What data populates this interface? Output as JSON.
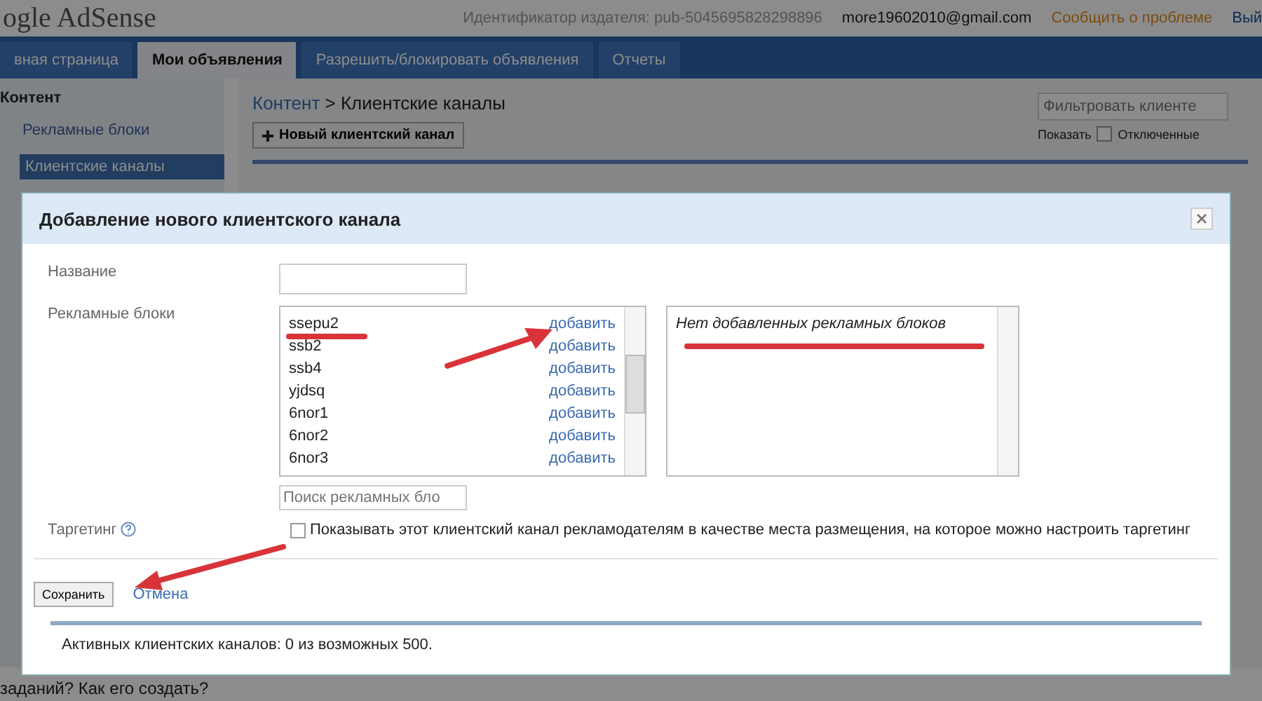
{
  "header": {
    "logo": "ogle AdSense",
    "publisher_id": "Идентификатор издателя: pub-5045695828298896",
    "email": "more19602010@gmail.com",
    "report_link": "Сообщить о проблеме",
    "cut_link": "Вый"
  },
  "nav_tabs": [
    {
      "label": "вная страница",
      "selected": false
    },
    {
      "label": "Мои объявления",
      "selected": true
    },
    {
      "label": "Разрешить/блокировать объявления",
      "selected": false
    },
    {
      "label": "Отчеты",
      "selected": false
    }
  ],
  "sidebar": {
    "heading": "Контент",
    "items": [
      {
        "label": "Рекламные блоки",
        "selected": false
      },
      {
        "label": "Клиентские каналы",
        "selected": true
      }
    ]
  },
  "content": {
    "breadcrumb_parent": "Контент",
    "breadcrumb_current": "> Клиентские каналы",
    "new_button": "Новый клиентский канал",
    "filter_placeholder": "Фильтровать клиенте",
    "show_label": "Показать",
    "disabled_filter": {
      "label": "Отключенные",
      "checked": false
    }
  },
  "footer_text": "заданий? Как его создать?",
  "dialog": {
    "title": "Добавление нового клиентского канала",
    "name_label": "Название",
    "ad_units_label": "Рекламные блоки",
    "ad_units": [
      {
        "name": "ssepu2",
        "action": "добавить"
      },
      {
        "name": "ssb2",
        "action": "добавить"
      },
      {
        "name": "ssb4",
        "action": "добавить"
      },
      {
        "name": "yjdsq",
        "action": "добавить"
      },
      {
        "name": "6nor1",
        "action": "добавить"
      },
      {
        "name": "6nor2",
        "action": "добавить"
      },
      {
        "name": "6nor3",
        "action": "добавить"
      }
    ],
    "search_placeholder": "Поиск рекламных бло",
    "added_empty": "Нет добавленных рекламных блоков",
    "targeting_label": "Таргетинг",
    "targeting": {
      "label": "Показывать этот клиентский канал рекламодателям в качестве места размещения, на которое можно настроить таргетинг",
      "checked": false
    },
    "save_button": "Сохранить",
    "cancel_link": "Отмена",
    "active_count": "Активных клиентских каналов: 0 из возможных 500."
  }
}
